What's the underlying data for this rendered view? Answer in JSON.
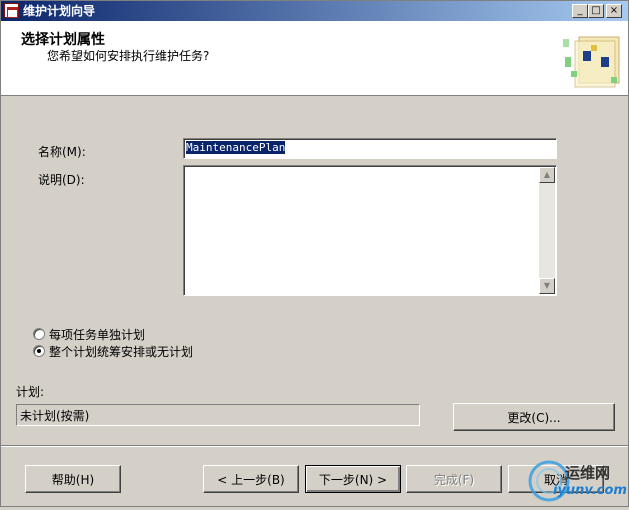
{
  "window": {
    "title": "维护计划向导",
    "controls": {
      "minimize": "_",
      "maximize": "□",
      "close": "×"
    }
  },
  "header": {
    "title": "选择计划属性",
    "subtitle": "您希望如何安排执行维护任务?"
  },
  "form": {
    "name_label": "名称(M):",
    "name_value": "MaintenancePlan",
    "description_label": "说明(D):",
    "description_value": ""
  },
  "options": {
    "separate": "每项任务单独计划",
    "whole": "整个计划统筹安排或无计划",
    "selected": "whole"
  },
  "schedule": {
    "label": "计划:",
    "value": "未计划(按需)",
    "change_button": "更改(C)..."
  },
  "footer": {
    "help": "帮助(H)",
    "back": "< 上一步(B)",
    "next": "下一步(N) >",
    "finish": "完成(F)",
    "cancel": "取消"
  },
  "watermark": {
    "brand": "运维网",
    "url": "iyunv.com"
  },
  "icons": {
    "app": "wizard-app-icon",
    "header_art": "maintenance-plan-icon"
  },
  "colors": {
    "titlebar_start": "#0a246a",
    "titlebar_end": "#a6caf0",
    "face": "#d4d0c8",
    "selection": "#0a246a"
  }
}
